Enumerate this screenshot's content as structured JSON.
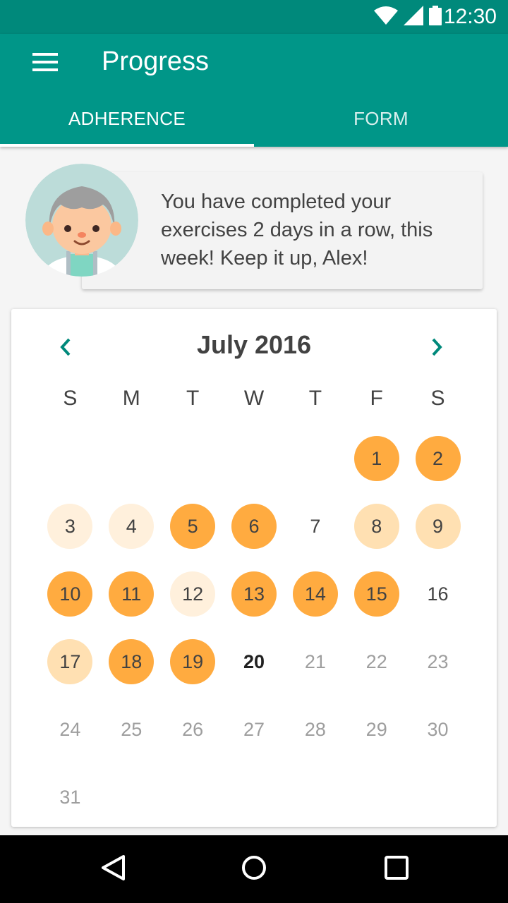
{
  "status_bar": {
    "time": "12:30"
  },
  "app_bar": {
    "title": "Progress"
  },
  "tabs": [
    {
      "label": "ADHERENCE",
      "selected": true
    },
    {
      "label": "FORM",
      "selected": false
    }
  ],
  "message": {
    "text": "You have completed your exercises 2 days in a row, this week! Keep it up, Alex!"
  },
  "calendar": {
    "month_label": "July 2016",
    "weekdays": [
      "S",
      "M",
      "T",
      "W",
      "T",
      "F",
      "S"
    ],
    "leading_blank_days": 5,
    "today": "20",
    "days": [
      {
        "label": "1",
        "status": "full"
      },
      {
        "label": "2",
        "status": "full"
      },
      {
        "label": "3",
        "status": "light"
      },
      {
        "label": "4",
        "status": "light"
      },
      {
        "label": "5",
        "status": "full"
      },
      {
        "label": "6",
        "status": "full"
      },
      {
        "label": "7",
        "status": "none"
      },
      {
        "label": "8",
        "status": "mid"
      },
      {
        "label": "9",
        "status": "mid"
      },
      {
        "label": "10",
        "status": "full"
      },
      {
        "label": "11",
        "status": "full"
      },
      {
        "label": "12",
        "status": "light"
      },
      {
        "label": "13",
        "status": "full"
      },
      {
        "label": "14",
        "status": "full"
      },
      {
        "label": "15",
        "status": "full"
      },
      {
        "label": "16",
        "status": "none"
      },
      {
        "label": "17",
        "status": "mid"
      },
      {
        "label": "18",
        "status": "full"
      },
      {
        "label": "19",
        "status": "full"
      },
      {
        "label": "20",
        "status": "today"
      },
      {
        "label": "21",
        "status": "future"
      },
      {
        "label": "22",
        "status": "future"
      },
      {
        "label": "23",
        "status": "future"
      },
      {
        "label": "24",
        "status": "future"
      },
      {
        "label": "25",
        "status": "future"
      },
      {
        "label": "26",
        "status": "future"
      },
      {
        "label": "27",
        "status": "future"
      },
      {
        "label": "28",
        "status": "future"
      },
      {
        "label": "29",
        "status": "future"
      },
      {
        "label": "30",
        "status": "future"
      },
      {
        "label": "31",
        "status": "future"
      }
    ]
  },
  "icons": {
    "menu": "menu-icon",
    "prev": "chevron-left-icon",
    "next": "chevron-right-icon",
    "back": "back-icon",
    "home": "home-icon",
    "recents": "recents-icon",
    "wifi": "wifi-icon",
    "signal": "signal-icon",
    "battery": "battery-icon"
  },
  "colors": {
    "primary": "#009688",
    "primary_dark": "#00897b",
    "accent": "#ffab40",
    "completed_partial": "#ffe0b2",
    "completed_low": "#fff0dc"
  }
}
